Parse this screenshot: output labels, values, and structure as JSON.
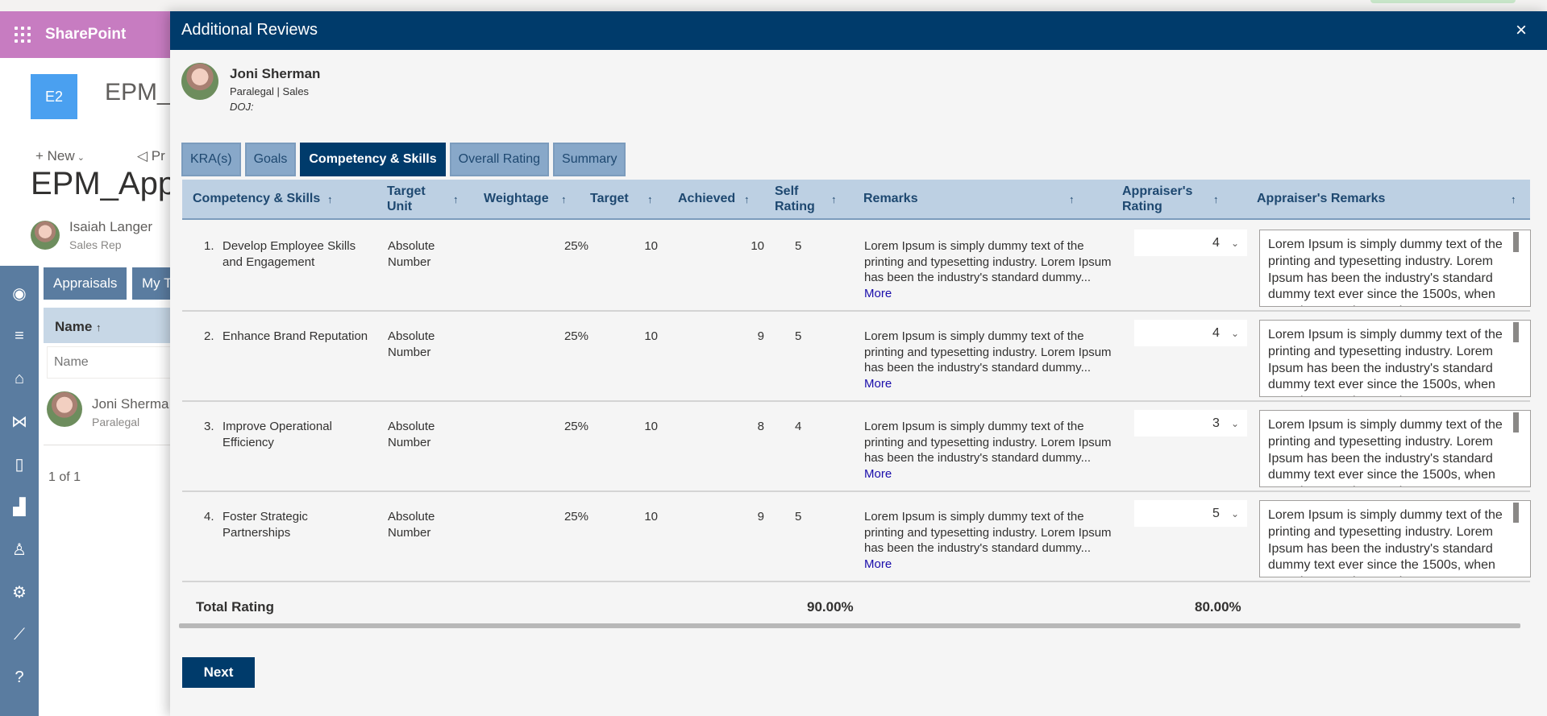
{
  "background": {
    "suite_brand": "SharePoint",
    "site_logo": "E2",
    "site_title": "EPM_A",
    "command_new": "New",
    "command_promote": "Pr",
    "page_title": "EPM_App",
    "author": {
      "name": "Isaiah Langer",
      "role": "Sales Rep"
    },
    "tabs": [
      "Appraisals",
      "My T"
    ],
    "list": {
      "name_header": "Name",
      "name_placeholder": "Name",
      "rows": [
        {
          "name": "Joni Sherma",
          "role": "Paralegal"
        }
      ],
      "pager": "1 of 1"
    },
    "rail_icons": [
      "user-circle-icon",
      "hamburger-icon",
      "home-icon",
      "handshake-icon",
      "document-icon",
      "analytics-icon",
      "user-settings-icon",
      "gear-icon",
      "trend-chart-icon",
      "help-icon"
    ]
  },
  "panel": {
    "title": "Additional Reviews",
    "close_icon": "×",
    "employee": {
      "name": "Joni Sherman",
      "role": "Paralegal | Sales",
      "doj": "DOJ:"
    },
    "tabs": [
      {
        "label": "KRA(s)",
        "active": false
      },
      {
        "label": "Goals",
        "active": false
      },
      {
        "label": "Competency & Skills",
        "active": true
      },
      {
        "label": "Overall Rating",
        "active": false
      },
      {
        "label": "Summary",
        "active": false
      }
    ],
    "columns": {
      "competency": "Competency & Skills",
      "target_unit_1": "Target",
      "target_unit_2": "Unit",
      "weightage": "Weightage",
      "target": "Target",
      "achieved": "Achieved",
      "self_rating_1": "Self",
      "self_rating_2": "Rating",
      "remarks": "Remarks",
      "appraiser_rating_1": "Appraiser's",
      "appraiser_rating_2": "Rating",
      "appraiser_remarks": "Appraiser's Remarks",
      "sort_glyph": "↑"
    },
    "rows": [
      {
        "index": "1.",
        "competency": "Develop Employee Skills and Engagement",
        "target_unit": "Absolute Number",
        "weightage": "25%",
        "target": "10",
        "achieved": "10",
        "self_rating": "5",
        "remarks": "Lorem Ipsum is simply dummy text of the printing and typesetting industry. Lorem Ipsum has been the industry's standard dummy...",
        "more": " More",
        "appraiser_rating": "4",
        "appraiser_remarks": "Lorem Ipsum is simply dummy text of the printing and typesetting industry. Lorem Ipsum has been the industry's standard dummy text ever since the 1500s, when an unknown printer took"
      },
      {
        "index": "2.",
        "competency": "Enhance Brand Reputation",
        "target_unit": "Absolute Number",
        "weightage": "25%",
        "target": "10",
        "achieved": "9",
        "self_rating": "5",
        "remarks": "Lorem Ipsum is simply dummy text of the printing and typesetting industry. Lorem Ipsum has been the industry's standard dummy...",
        "more": " More",
        "appraiser_rating": "4",
        "appraiser_remarks": "Lorem Ipsum is simply dummy text of the printing and typesetting industry. Lorem Ipsum has been the industry's standard dummy text ever since the 1500s, when an unknown printer took"
      },
      {
        "index": "3.",
        "competency": "Improve Operational Efficiency",
        "target_unit": "Absolute Number",
        "weightage": "25%",
        "target": "10",
        "achieved": "8",
        "self_rating": "4",
        "remarks": "Lorem Ipsum is simply dummy text of the printing and typesetting industry. Lorem Ipsum has been the industry's standard dummy...",
        "more": " More",
        "appraiser_rating": "3",
        "appraiser_remarks": "Lorem Ipsum is simply dummy text of the printing and typesetting industry. Lorem Ipsum has been the industry's standard dummy text ever since the 1500s, when an unknown printer took"
      },
      {
        "index": "4.",
        "competency": "Foster Strategic Partnerships",
        "target_unit": "Absolute Number",
        "weightage": "25%",
        "target": "10",
        "achieved": "9",
        "self_rating": "5",
        "remarks": "Lorem Ipsum is simply dummy text of the printing and typesetting industry. Lorem Ipsum has been the industry's standard dummy...",
        "more": " More",
        "appraiser_rating": "5",
        "appraiser_remarks": "Lorem Ipsum is simply dummy text of the printing and typesetting industry. Lorem Ipsum has been the industry's standard dummy text ever since the 1500s, when an unknown printer took"
      }
    ],
    "total": {
      "label": "Total Rating",
      "self": "90.00%",
      "appraiser": "80.00%"
    },
    "next_label": "Next"
  },
  "colors": {
    "header_navy": "#003b6b",
    "tab_inactive": "#88a8c9",
    "grid_header": "#bdd0e3",
    "suite_purple": "#c77cc1",
    "rail_blue": "#5a7ca0"
  }
}
